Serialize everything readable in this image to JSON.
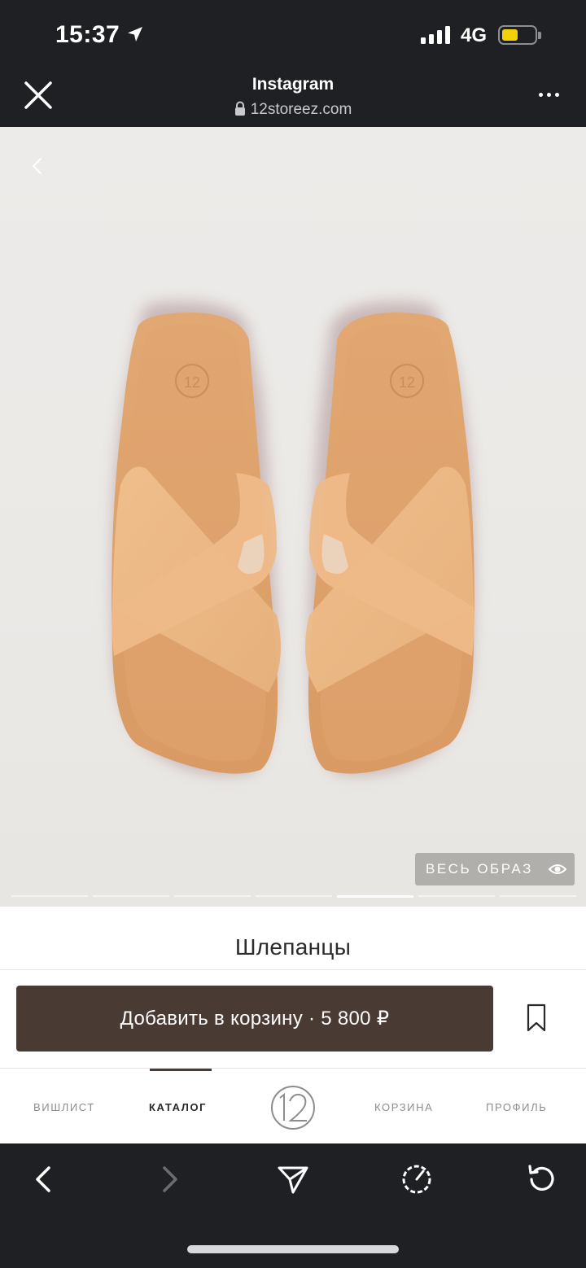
{
  "status_bar": {
    "time": "15:37",
    "network": "4G",
    "battery_level_fraction": 0.45,
    "battery_color": "#f4d20a"
  },
  "browser_header": {
    "title": "Instagram",
    "url": "12storeez.com",
    "icons": {
      "close": "close-icon",
      "lock": "lock-icon",
      "more": "more-icon"
    }
  },
  "product_image": {
    "icons": {
      "back": "chevron-left-icon",
      "look": "eye-icon"
    },
    "look_button_label": "ВЕСЬ ОБРАЗ",
    "slide_count": 7,
    "active_slide": 5
  },
  "product": {
    "title": "Шлепанцы",
    "add_to_cart_label": "Добавить в корзину · 5 800 ₽",
    "accent_color": "#4a3a34"
  },
  "site_nav": {
    "items": [
      {
        "label": "ВИШЛИСТ",
        "active": false
      },
      {
        "label": "КАТАЛОГ",
        "active": true
      },
      {
        "label": "КОРЗИНА",
        "active": false
      },
      {
        "label": "ПРОФИЛЬ",
        "active": false
      }
    ],
    "logo": "12-storeez-logo"
  },
  "toolbar": {
    "icons": [
      "back-arrow-icon",
      "forward-arrow-icon",
      "share-icon",
      "speed-icon",
      "reload-icon"
    ]
  }
}
